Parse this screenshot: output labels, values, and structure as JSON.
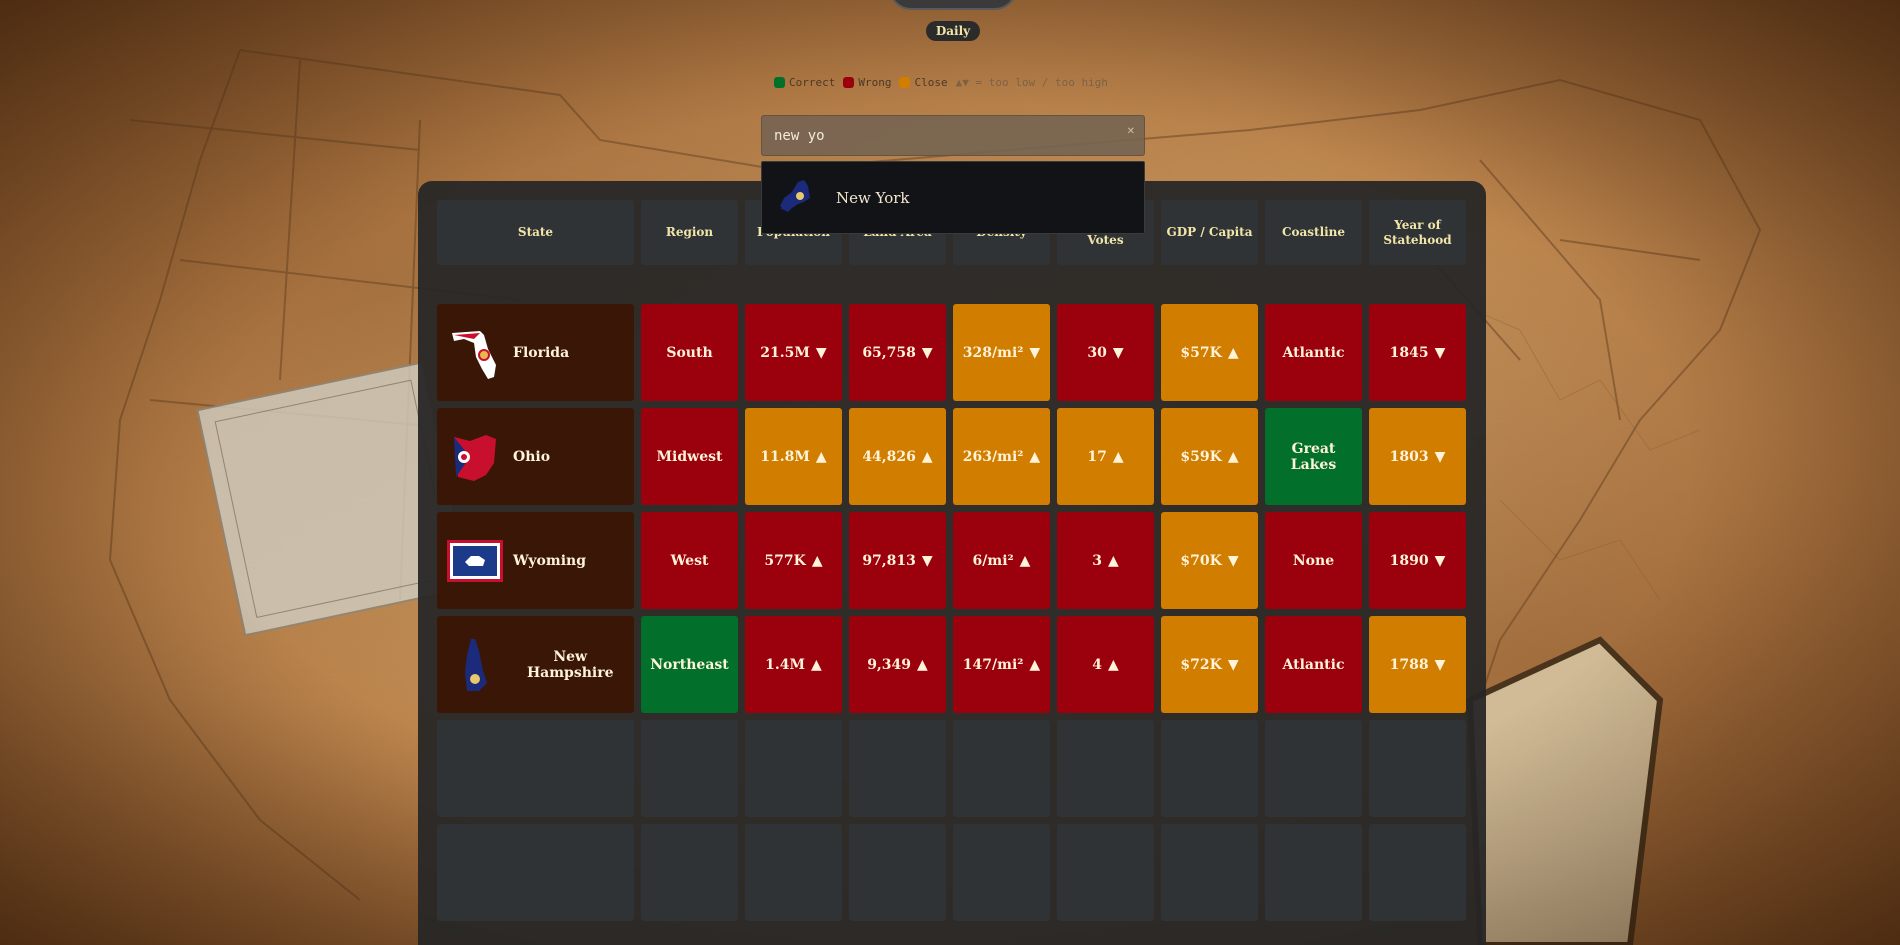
{
  "header": {
    "mode_label": "Daily"
  },
  "legend": {
    "correct": "Correct",
    "wrong": "Wrong",
    "close": "Close",
    "hint": "▲▼ = too low / too high",
    "colors": {
      "correct": "#02702a",
      "wrong": "#9b010d",
      "close": "#d07d00"
    }
  },
  "search": {
    "value": "new yo",
    "clear_icon": "close-icon"
  },
  "dropdown": {
    "options": [
      {
        "label": "New York",
        "icon": "new-york-flag-icon"
      }
    ]
  },
  "columns": [
    "State",
    "Region",
    "Population",
    "Land Area",
    "Density",
    "Electoral Votes",
    "GDP / Capita",
    "Coastline",
    "Year of Statehood"
  ],
  "guesses": [
    {
      "state": "Florida",
      "flag": "florida-shape-icon",
      "cells": [
        {
          "text": "South",
          "status": "red",
          "arrow": ""
        },
        {
          "text": "21.5M",
          "status": "red",
          "arrow": "▼"
        },
        {
          "text": "65,758",
          "status": "red",
          "arrow": "▼"
        },
        {
          "text": "328/mi²",
          "status": "orange",
          "arrow": "▼"
        },
        {
          "text": "30",
          "status": "red",
          "arrow": "▼"
        },
        {
          "text": "$57K",
          "status": "orange",
          "arrow": "▲"
        },
        {
          "text": "Atlantic",
          "status": "red",
          "arrow": ""
        },
        {
          "text": "1845",
          "status": "red",
          "arrow": "▼"
        }
      ]
    },
    {
      "state": "Ohio",
      "flag": "ohio-shape-icon",
      "cells": [
        {
          "text": "Midwest",
          "status": "red",
          "arrow": ""
        },
        {
          "text": "11.8M",
          "status": "orange",
          "arrow": "▲"
        },
        {
          "text": "44,826",
          "status": "orange",
          "arrow": "▲"
        },
        {
          "text": "263/mi²",
          "status": "orange",
          "arrow": "▲"
        },
        {
          "text": "17",
          "status": "orange",
          "arrow": "▲"
        },
        {
          "text": "$59K",
          "status": "orange",
          "arrow": "▲"
        },
        {
          "text": "Great Lakes",
          "status": "green",
          "arrow": ""
        },
        {
          "text": "1803",
          "status": "orange",
          "arrow": "▼"
        }
      ]
    },
    {
      "state": "Wyoming",
      "flag": "wyoming-flag-icon",
      "cells": [
        {
          "text": "West",
          "status": "red",
          "arrow": ""
        },
        {
          "text": "577K",
          "status": "red",
          "arrow": "▲"
        },
        {
          "text": "97,813",
          "status": "red",
          "arrow": "▼"
        },
        {
          "text": "6/mi²",
          "status": "red",
          "arrow": "▲"
        },
        {
          "text": "3",
          "status": "red",
          "arrow": "▲"
        },
        {
          "text": "$70K",
          "status": "orange",
          "arrow": "▼"
        },
        {
          "text": "None",
          "status": "red",
          "arrow": ""
        },
        {
          "text": "1890",
          "status": "red",
          "arrow": "▼"
        }
      ]
    },
    {
      "state": "New Hampshire",
      "flag": "new-hampshire-shape-icon",
      "cells": [
        {
          "text": "Northeast",
          "status": "green",
          "arrow": ""
        },
        {
          "text": "1.4M",
          "status": "red",
          "arrow": "▲"
        },
        {
          "text": "9,349",
          "status": "red",
          "arrow": "▲"
        },
        {
          "text": "147/mi²",
          "status": "red",
          "arrow": "▲"
        },
        {
          "text": "4",
          "status": "red",
          "arrow": "▲"
        },
        {
          "text": "$72K",
          "status": "orange",
          "arrow": "▼"
        },
        {
          "text": "Atlantic",
          "status": "red",
          "arrow": ""
        },
        {
          "text": "1788",
          "status": "orange",
          "arrow": "▼"
        }
      ]
    }
  ],
  "empty_rows": 2
}
